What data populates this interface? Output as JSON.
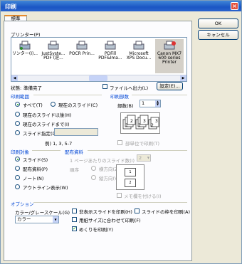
{
  "window": {
    "title": "印刷"
  },
  "tabs": [
    {
      "label": "標準"
    }
  ],
  "buttons": {
    "ok": "OK",
    "cancel": "キャンセル",
    "settings": "設定(E)..."
  },
  "printer": {
    "label": "プリンター(P)",
    "items": [
      {
        "name": "リンター(I)..."
      },
      {
        "name": "JustSyste... PDF (逆..."
      },
      {
        "name": "POCR Prin..."
      },
      {
        "name": "PDFill PDF&Ima..."
      },
      {
        "name": "Microsoft XPS Docu..."
      },
      {
        "name": "Canon MX7 600 series Printer",
        "selected": true
      }
    ],
    "status_label": "状態:",
    "status_value": "準備完了",
    "file_output": "ファイルへ出力(L)"
  },
  "print_range": {
    "label": "印刷範囲",
    "options": [
      "すべて(T)",
      "現在のスライド(C)",
      "現在のスライド以後(H)",
      "現在のスライドまで(I)",
      "スライド指定(D)"
    ],
    "current_slide": "現在のスライド(C)",
    "example": "例) 1, 3, 5-7"
  },
  "copies": {
    "label": "印刷部数",
    "count_label": "部数(B)",
    "count_value": "1",
    "collate": "部単位で印刷(T)"
  },
  "print_what": {
    "label": "印刷対象",
    "options": [
      "スライド(S)",
      "配布資料(P)",
      "ノート(N)",
      "アウトライン表示(W)"
    ]
  },
  "handouts": {
    "label": "配布資料",
    "per_page": "1 ページあたりのスライド数(I)",
    "per_page_value": "2",
    "order_label": "順序",
    "horizontal": "横方向(Z)",
    "vertical": "縦方向(V)",
    "hide_title": "メモ欄を付ける(I)"
  },
  "options": {
    "label": "オプション",
    "color_label": "カラー/グレースケール(G)",
    "color_value": "カラー",
    "hidden_slides": "非表示スライドを印刷(H)",
    "scale_to_fit": "用紙サイズに合わせて印刷(F)",
    "frame": "スライドの枠を印刷(A)",
    "comments": "めくりを印刷(Y)"
  }
}
